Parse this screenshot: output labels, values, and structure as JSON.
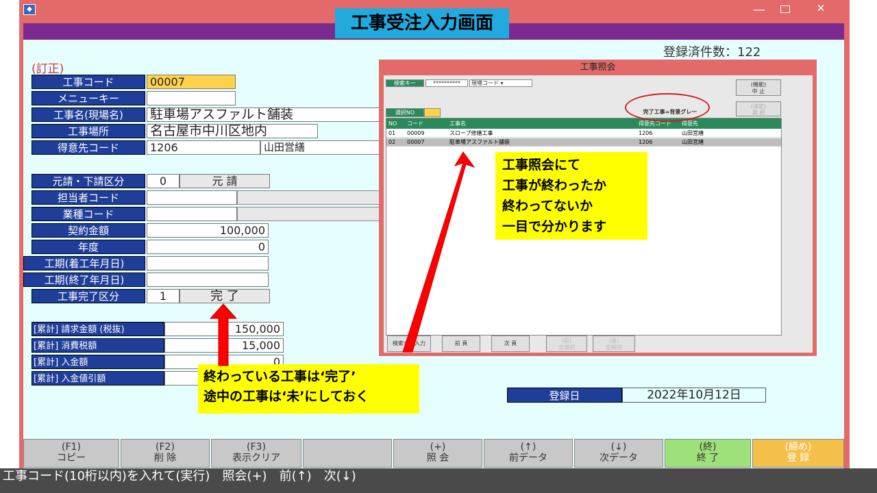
{
  "window": {
    "minimize": "—",
    "close": "✕"
  },
  "banner": "工事受注入力画面",
  "header": {
    "registered_count": "登録済件数：122",
    "mode": "(訂正)"
  },
  "form": {
    "labels": {
      "construction_code": "工事コード",
      "menu_key": "メニューキー",
      "site_name": "工事名(現場名)",
      "site_location": "工事場所",
      "customer_code": "得意先コード",
      "contract_type": "元請・下請区分",
      "staff_code": "担当者コード",
      "industry_code": "業種コード",
      "contract_amount": "契約金額",
      "fiscal_year": "年度",
      "start_date": "工期(着工年月日)",
      "end_date": "工期(終了年月日)",
      "completion_type": "工事完了区分"
    },
    "values": {
      "construction_code": "00007",
      "site_name": "駐車場アスファルト舗装",
      "site_location": "名古屋市中川区地内",
      "customer_code": "1206",
      "customer_name": "山田営繕",
      "contract_type_code": "0",
      "contract_type_name": "元 請",
      "contract_amount": "100,000",
      "fiscal_year": "0",
      "completion_code": "1",
      "completion_name": "完 了"
    }
  },
  "totals": {
    "labels": [
      "[累計] 請求金額 (税抜)",
      "[累計] 消費税額",
      "[累計] 入金額",
      "[累計] 入金値引額"
    ],
    "values": [
      "150,000",
      "15,000",
      "0",
      ""
    ]
  },
  "registration": {
    "label": "登録日",
    "date": "2022年10月12日"
  },
  "popup": {
    "title": "工事照会",
    "search_label": "検索キー",
    "search_value": "**********",
    "search_field": "現場コード",
    "cancel_button": "(機能)\n中 止",
    "right_button2": "(決定)\n選 択",
    "select_label": "選択NO",
    "legend": "完了工事=背景グレー",
    "columns": [
      "NO",
      "コード",
      "工事名",
      "得意先コード",
      "得意先"
    ],
    "rows": [
      [
        "01",
        "00009",
        "スロープ修繕工事",
        "1206",
        "山田営繕"
      ],
      [
        "02",
        "00007",
        "駐車場アスファルト舗装",
        "1206",
        "山田営繕"
      ]
    ],
    "bottom_buttons": [
      "検索キー入力",
      "前 頁",
      "次 頁",
      "(前)\n全選択",
      "(後)\n全解除"
    ]
  },
  "callouts": {
    "popup_note": [
      "工事照会にて",
      "工事が終わったか",
      "終わってないか",
      "一目で分かります"
    ],
    "status_note": [
      "終わっている工事は‘完了’",
      "途中の工事は‘未’にしておく"
    ]
  },
  "fkeys": [
    {
      "key": "(F1)",
      "label": "コピー"
    },
    {
      "key": "(F2)",
      "label": "削 除"
    },
    {
      "key": "(F3)",
      "label": "表示クリア"
    },
    {
      "key": "",
      "label": ""
    },
    {
      "key": "(+)",
      "label": "照 会"
    },
    {
      "key": "(↑)",
      "label": "前データ"
    },
    {
      "key": "(↓)",
      "label": "次データ"
    },
    {
      "key": "(終)",
      "label": "終 了"
    },
    {
      "key": "(締め)",
      "label": "登 録"
    }
  ],
  "statusbar": "工事コード(10桁以内)を入れて(実行)　照会(+)　前(↑)　次(↓)",
  "colors": {
    "titlebar": "#e46a6a",
    "purple": "#7b2a8f",
    "label_blue": "#1f3e9a",
    "callout": "#ffff00",
    "banner": "#22aadf"
  }
}
